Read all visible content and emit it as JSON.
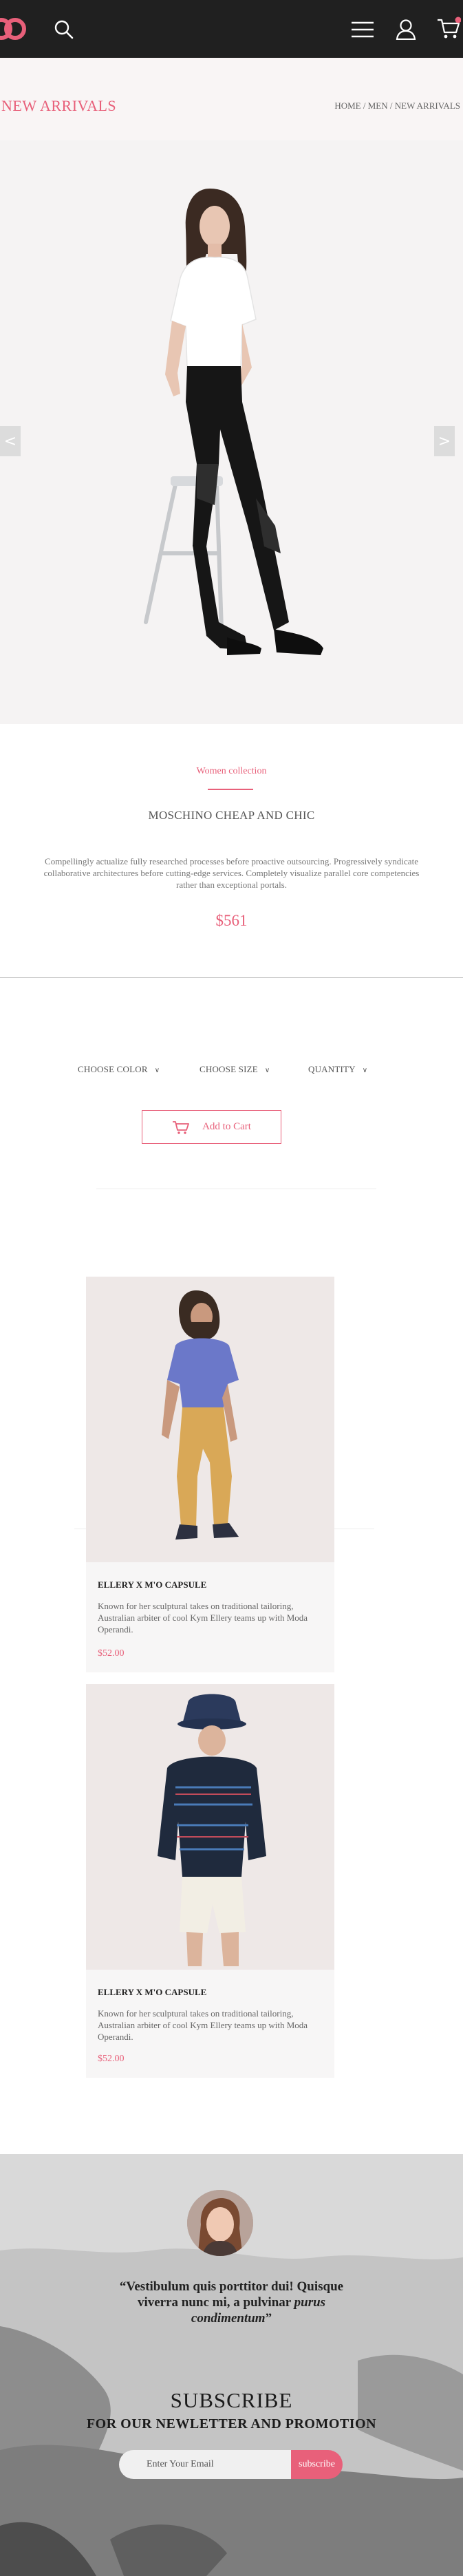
{
  "header": {
    "logo_icon": "brand-logo-icon",
    "icons": [
      "search-icon",
      "menu-icon",
      "user-icon",
      "cart-icon"
    ],
    "cart_badge_color": "#e8607a"
  },
  "title_band": {
    "title": "NEW ARRIVALS",
    "breadcrumb": [
      "HOME",
      "MEN",
      "NEW ARRIVALS"
    ],
    "separator": " / "
  },
  "hero": {
    "prev_label": "<",
    "next_label": ">"
  },
  "product": {
    "collection": "Women collection",
    "name": "MOSCHINO CHEAP AND CHIC",
    "description": "Compellingly actualize fully researched processes before proactive outsourcing. Progressively syndicate collaborative architectures before cutting-edge services. Completely visualize parallel core competencies rather than exceptional portals.",
    "price": "$561",
    "options": {
      "color_label": "CHOOSE COLOR",
      "size_label": "CHOOSE SIZE",
      "quantity_label": "QUANTITY"
    },
    "add_to_cart": "Add to Cart"
  },
  "related": [
    {
      "title": "ELLERY X M'O CAPSULE",
      "description": "Known for her sculptural takes on traditional tailoring, Australian arbiter of cool Kym Ellery teams up with Moda Operandi.",
      "price": "$52.00"
    },
    {
      "title": "ELLERY X M'O CAPSULE",
      "description": "Known for her sculptural takes on traditional tailoring, Australian arbiter of cool Kym Ellery teams up with Moda Operandi.",
      "price": "$52.00"
    }
  ],
  "testimonial": {
    "quote_start": "“Vestibulum quis porttitor dui! Quisque viverra nunc mi, a pulvinar ",
    "quote_italic": "purus condimentum",
    "quote_end": "”"
  },
  "subscribe": {
    "title": "SUBSCRIBE",
    "subtitle": "FOR OUR NEWLETTER AND PROMOTION",
    "email_placeholder": "Enter Your Email",
    "button": "subscribe"
  },
  "colors": {
    "accent": "#e8607a",
    "header_bg": "#202020",
    "title_band_bg": "#f9f5f5"
  }
}
